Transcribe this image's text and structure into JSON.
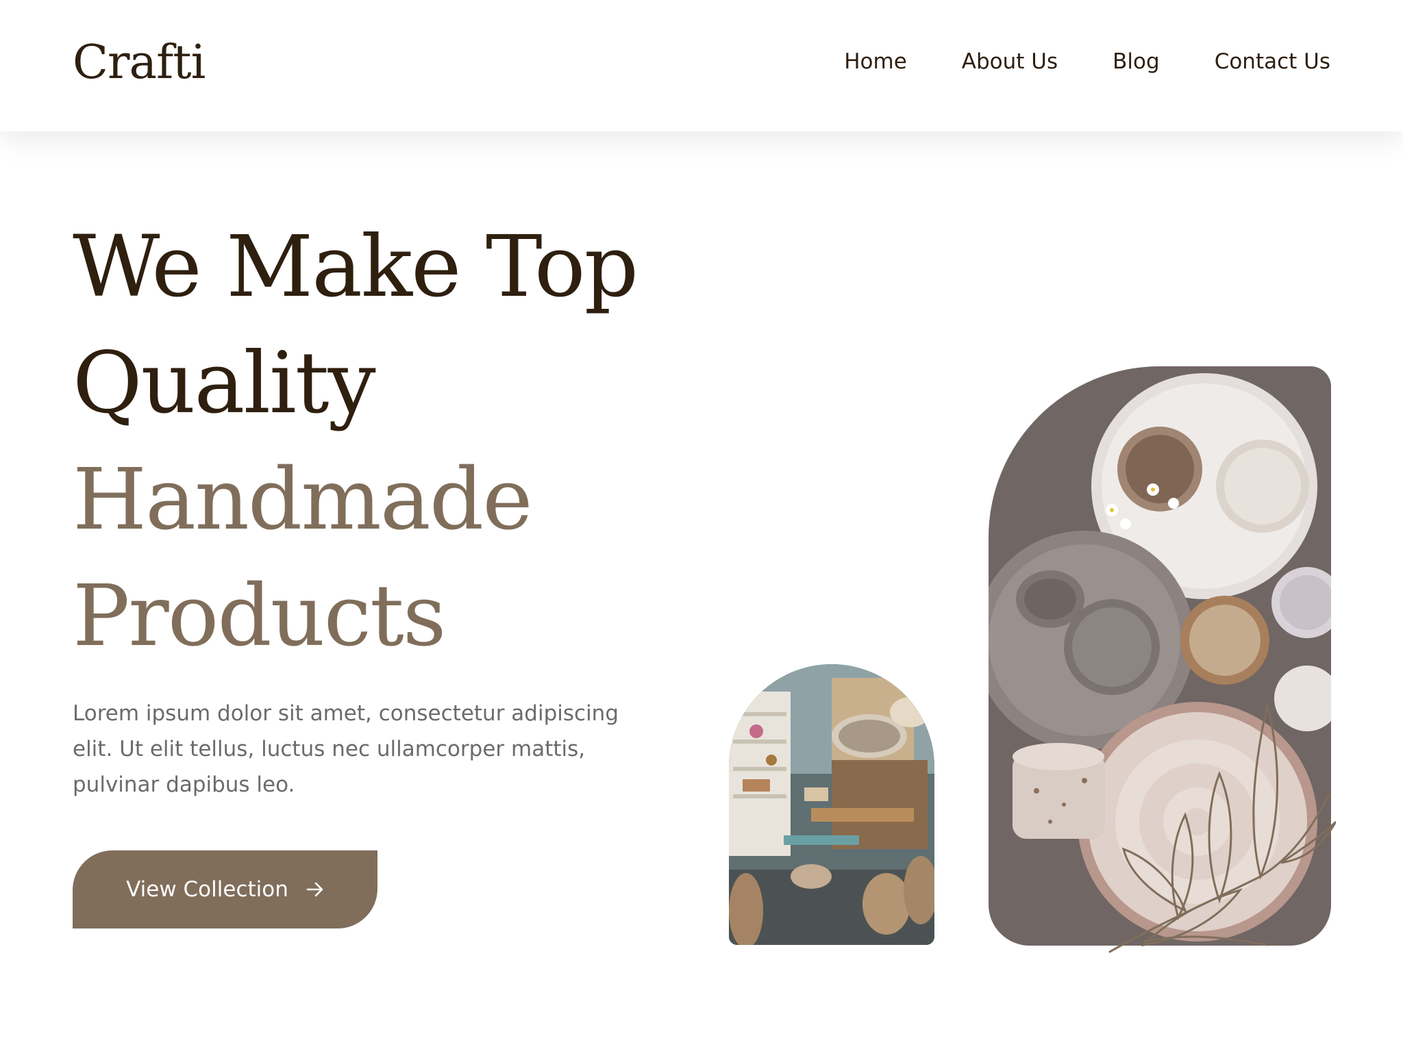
{
  "header": {
    "logo": "Crafti",
    "nav": [
      "Home",
      "About Us",
      "Blog",
      "Contact Us"
    ]
  },
  "hero": {
    "title_line1": "We Make Top",
    "title_line2": "Quality",
    "title_line3": "Handmade",
    "title_line4": "Products",
    "description": "Lorem ipsum dolor sit amet, consectetur adipiscing elit. Ut elit tellus, luctus nec ullamcorper mattis, pulvinar dapibus leo.",
    "cta_label": "View Collection"
  },
  "colors": {
    "dark": "#2e1f0f",
    "accent": "#806e5b",
    "body_text": "#6b6b6b"
  },
  "icons": {
    "cta": "arrow-right-icon",
    "decoration": "leaf-branch-icon"
  }
}
